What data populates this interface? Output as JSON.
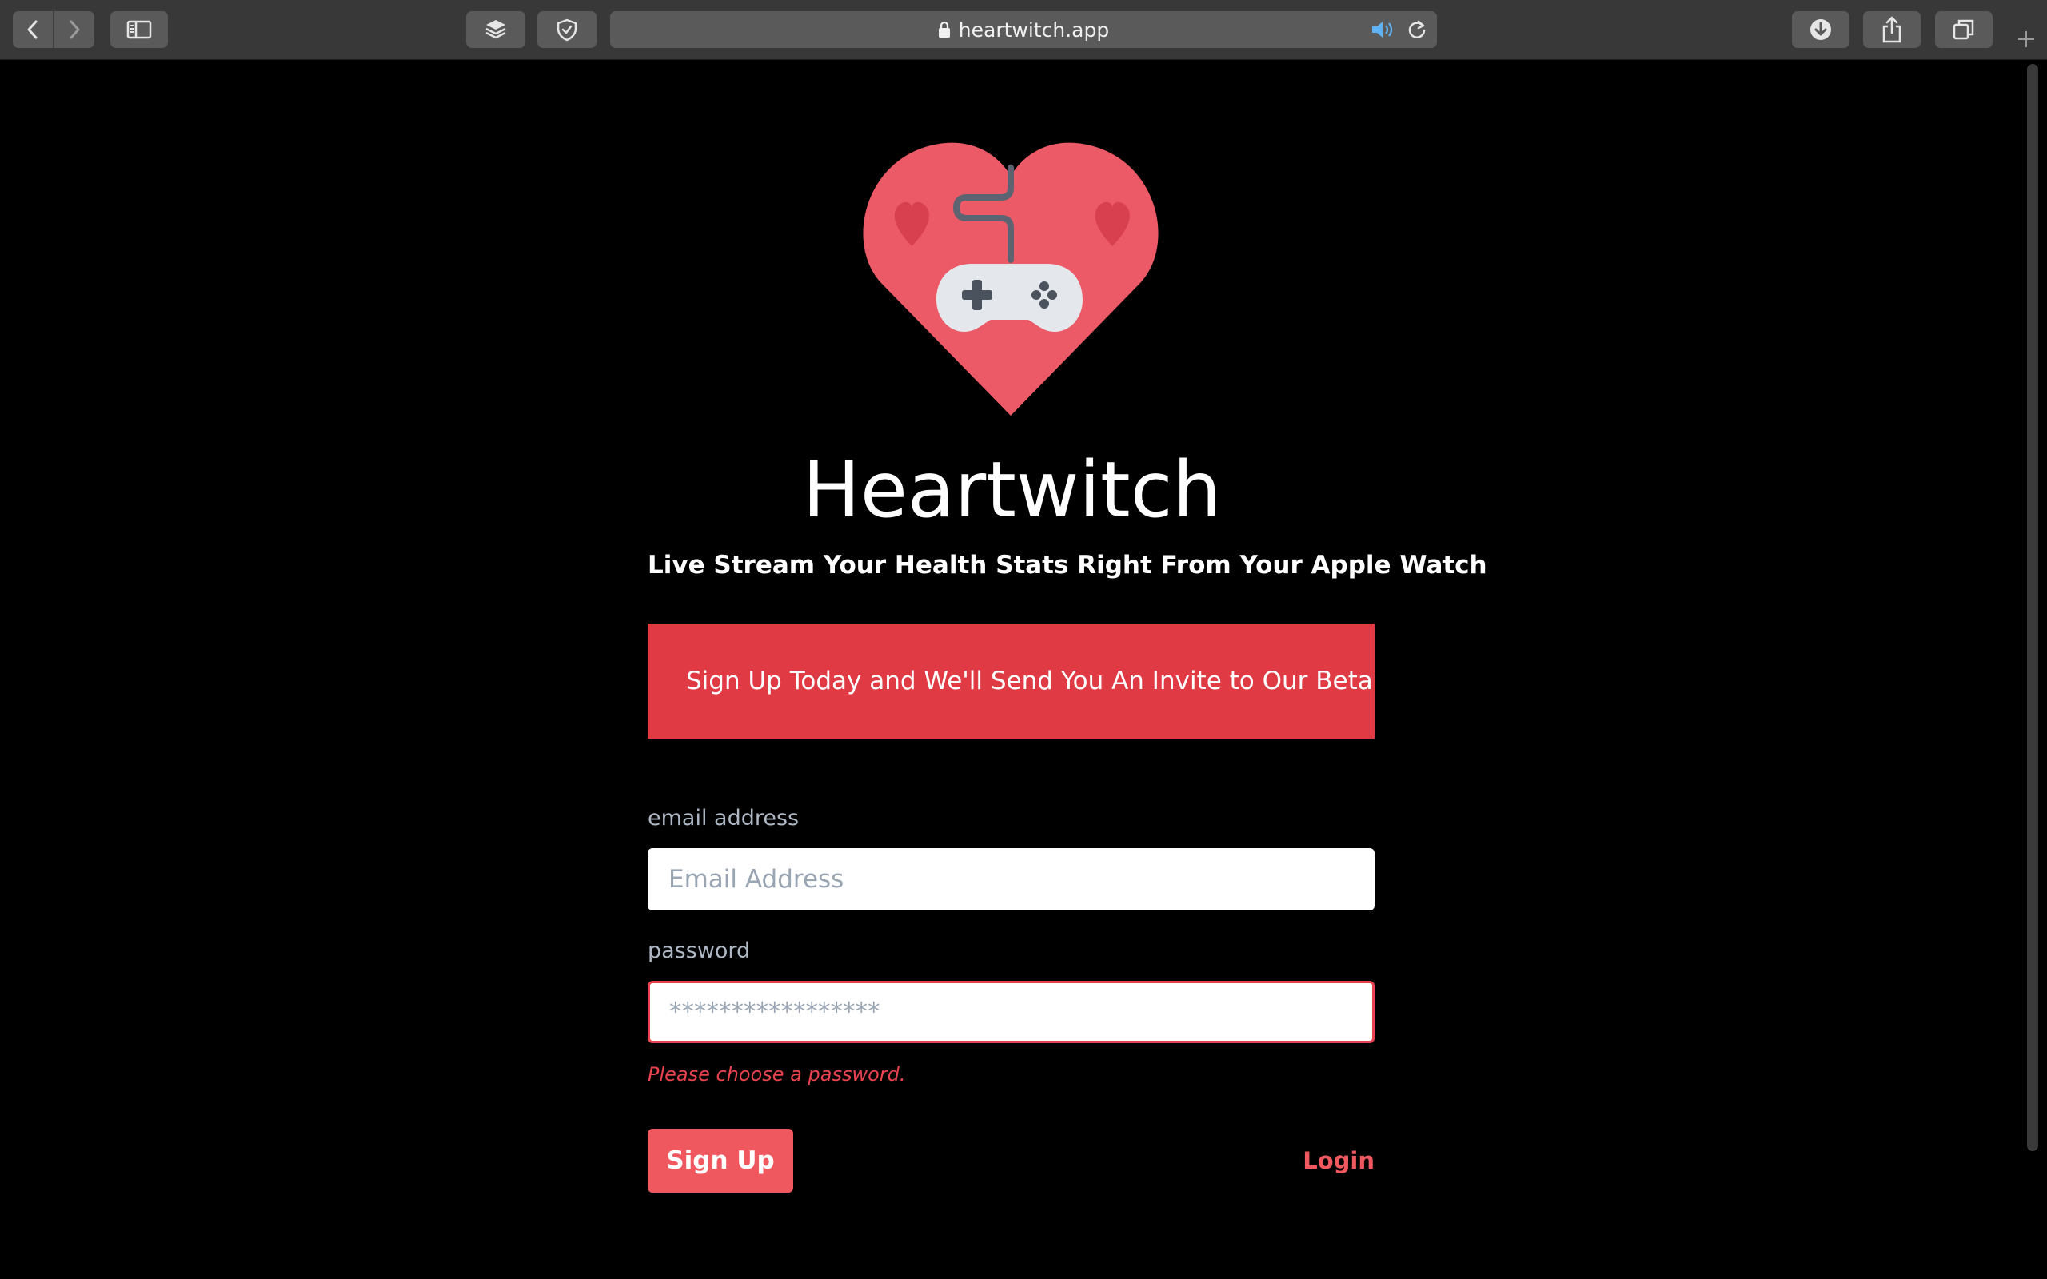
{
  "browser": {
    "url": "heartwitch.app",
    "icons": {
      "back": "chevron-left-icon",
      "forward": "chevron-right-icon",
      "sidebar": "sidebar-icon",
      "layers": "layers-icon",
      "shield": "shield-icon",
      "lock": "lock-icon",
      "audio": "speaker-icon",
      "reload": "reload-icon",
      "download": "download-icon",
      "share": "share-icon",
      "tabs": "tabs-icon",
      "new_tab": "plus-icon"
    }
  },
  "page": {
    "title": "Heartwitch",
    "subtitle": "Live Stream Your Health Stats Right From Your Apple Watch",
    "banner": "Sign Up Today and We'll Send You An Invite to Our Beta",
    "form": {
      "email_label": "email address",
      "email_placeholder": "Email Address",
      "email_value": "",
      "password_label": "password",
      "password_placeholder": "*****************",
      "password_value": "",
      "password_error": "Please choose a password.",
      "submit_label": "Sign Up",
      "login_label": "Login"
    },
    "colors": {
      "background": "#000000",
      "heart": "#ec5a67",
      "banner": "#e03b44",
      "accent": "#f0585f",
      "error": "#e8434e",
      "label": "#aeb7c4"
    }
  }
}
